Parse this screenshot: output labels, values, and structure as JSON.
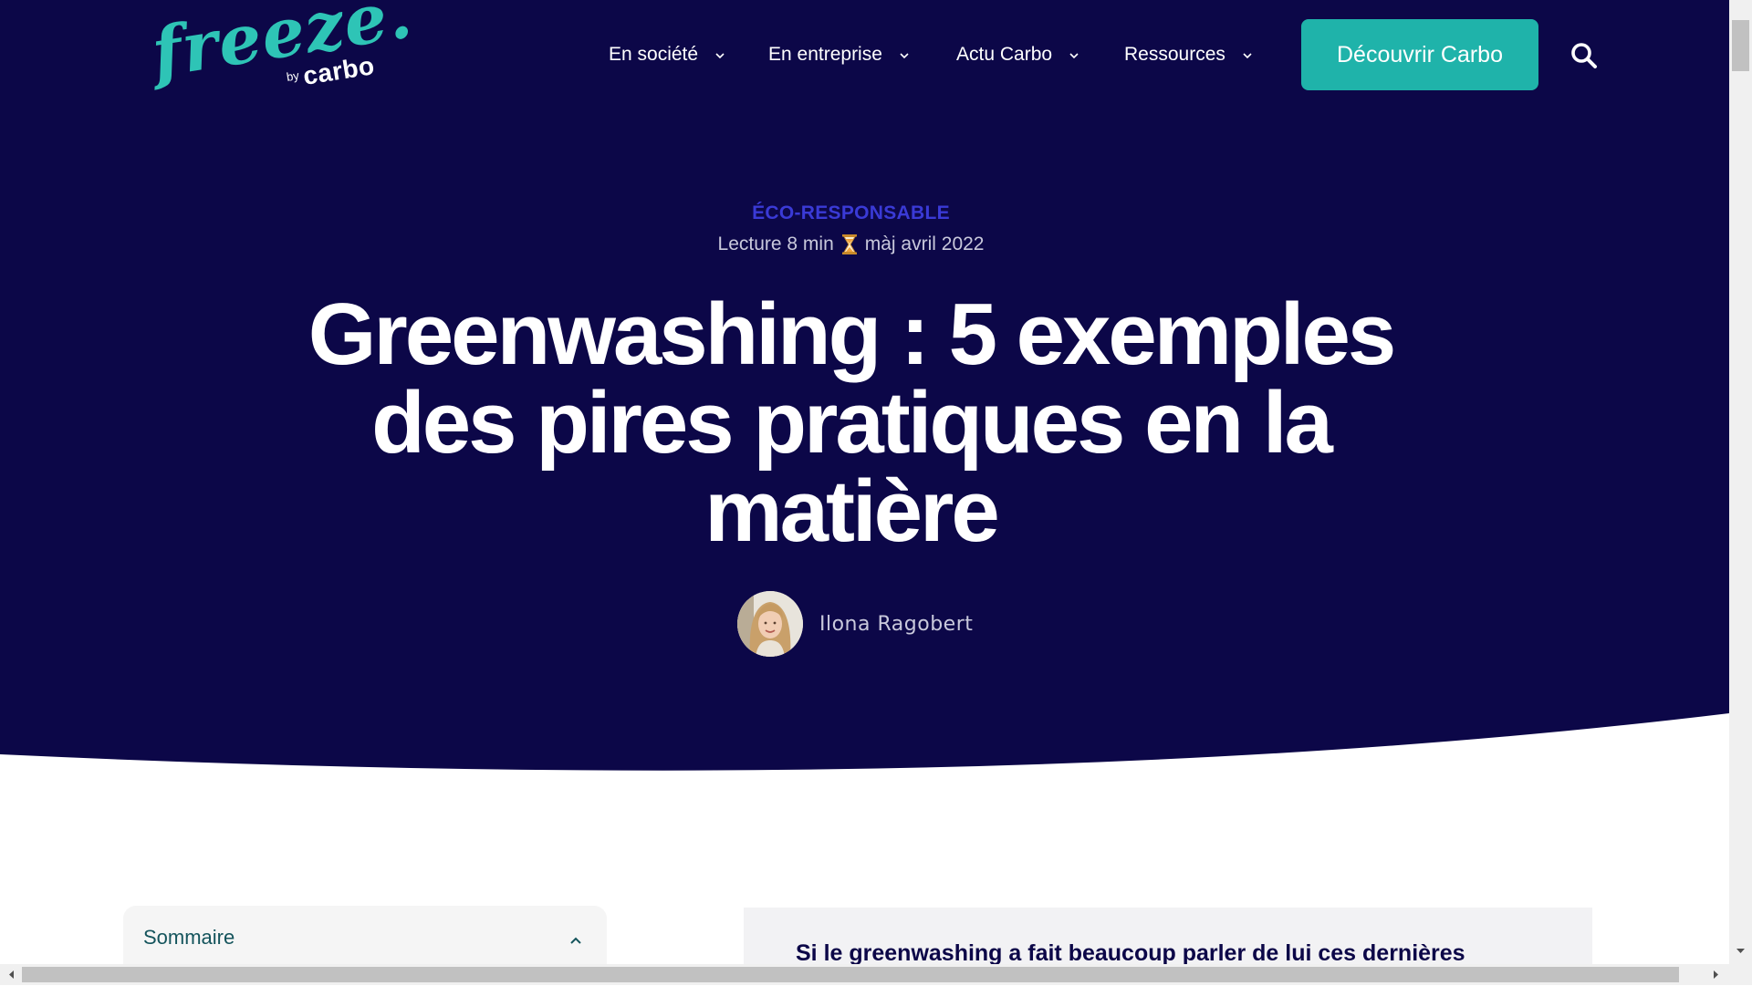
{
  "colors": {
    "hero_bg": "#0c0748",
    "accent_teal": "#1fb3aa",
    "category": "#3a3ad6",
    "meta_text": "#c9c9dc",
    "title_text": "#ffffff"
  },
  "header": {
    "logo_text": "freeze.",
    "logo_by": "by",
    "logo_brand": "carbo",
    "nav": [
      {
        "label": "En société",
        "icon": "chevron-down-icon"
      },
      {
        "label": "En entreprise",
        "icon": "chevron-down-icon"
      },
      {
        "label": "Actu Carbo",
        "icon": "chevron-down-icon"
      },
      {
        "label": "Ressources",
        "icon": "chevron-down-icon"
      }
    ],
    "cta_label": "Découvrir Carbo",
    "search_icon": "search-icon"
  },
  "article": {
    "category": "ÉCO-RESPONSABLE",
    "read_time": "Lecture 8 min",
    "updated": "màj avril 2022",
    "meta_icon": "hourglass-icon",
    "title": "Greenwashing : 5 exemples des pires pratiques en la matière",
    "author": "Ilona Ragobert"
  },
  "toc": {
    "label": "Sommaire",
    "icon": "chevron-up-icon"
  },
  "intro": {
    "text": "Si le greenwashing a fait beaucoup parler de lui ces dernières"
  }
}
